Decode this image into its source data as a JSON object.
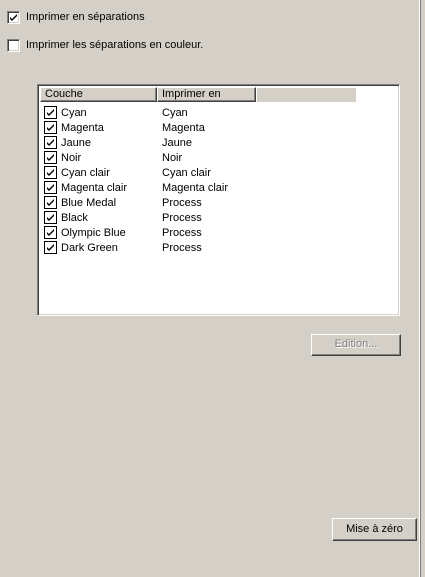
{
  "options": {
    "print_separations_label": "Imprimer en séparations",
    "print_separations_checked": true,
    "print_color_label": "Imprimer les séparations en couleur.",
    "print_color_checked": false
  },
  "layers": {
    "columns": [
      "Couche",
      "Imprimer en"
    ],
    "rows": [
      {
        "name": "Cyan",
        "print_as": "Cyan",
        "checked": true
      },
      {
        "name": "Magenta",
        "print_as": "Magenta",
        "checked": true
      },
      {
        "name": "Jaune",
        "print_as": "Jaune",
        "checked": true
      },
      {
        "name": "Noir",
        "print_as": "Noir",
        "checked": true
      },
      {
        "name": "Cyan clair",
        "print_as": "Cyan clair",
        "checked": true
      },
      {
        "name": "Magenta clair",
        "print_as": "Magenta clair",
        "checked": true
      },
      {
        "name": "Blue Medal",
        "print_as": "Process",
        "checked": true
      },
      {
        "name": "Black",
        "print_as": "Process",
        "checked": true
      },
      {
        "name": "Olympic Blue",
        "print_as": "Process",
        "checked": true
      },
      {
        "name": "Dark Green",
        "print_as": "Process",
        "checked": true
      }
    ]
  },
  "buttons": {
    "edit_label": "Edition...",
    "edit_enabled": false,
    "reset_label": "Mise à zéro"
  }
}
